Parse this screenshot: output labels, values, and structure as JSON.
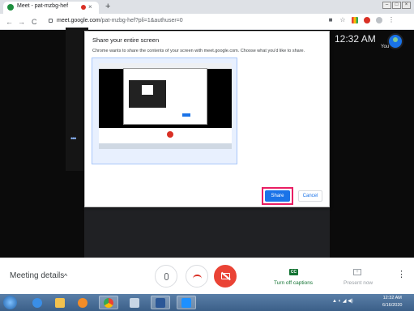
{
  "browser": {
    "tab_title": "Meet - pat-mzbg-hef",
    "tab_close": "×",
    "new_tab": "+",
    "nav_back": "←",
    "nav_forward": "→",
    "nav_reload": "C",
    "url_host": "meet.google.com",
    "url_path": "/pat-mzbg-hef?pli=1&authuser=0",
    "star_icon": "☆",
    "menu_icon": "⋮",
    "win_min": "–",
    "win_max": "□",
    "win_close": "×"
  },
  "meet": {
    "clock": "12:32 AM",
    "self_label": "You",
    "tile_dots": "•••"
  },
  "dialog": {
    "title": "Share your entire screen",
    "description": "Chrome wants to share the contents of your screen with meet.google.com. Choose what you'd like to share.",
    "share_label": "Share",
    "cancel_label": "Cancel"
  },
  "meetbar": {
    "details_label": "Meeting details",
    "details_chevron": "^",
    "captions_icon": "CC",
    "captions_label": "Turn off captions",
    "present_icon": "+",
    "present_label": "Present now",
    "more_icon": "⋮"
  },
  "taskbar": {
    "tray_text": "▲ ◐ ◢ ◀)",
    "time": "12:32 AM",
    "date": "6/16/2020",
    "apps": [
      "ie-icon",
      "explorer-icon",
      "media-player-icon",
      "chrome-icon",
      "paint-icon",
      "word-icon",
      "mail-icon"
    ]
  },
  "colors": {
    "accent": "#1a73e8",
    "highlight": "#e91e63",
    "danger": "#ea4335",
    "captions_green": "#137333"
  }
}
